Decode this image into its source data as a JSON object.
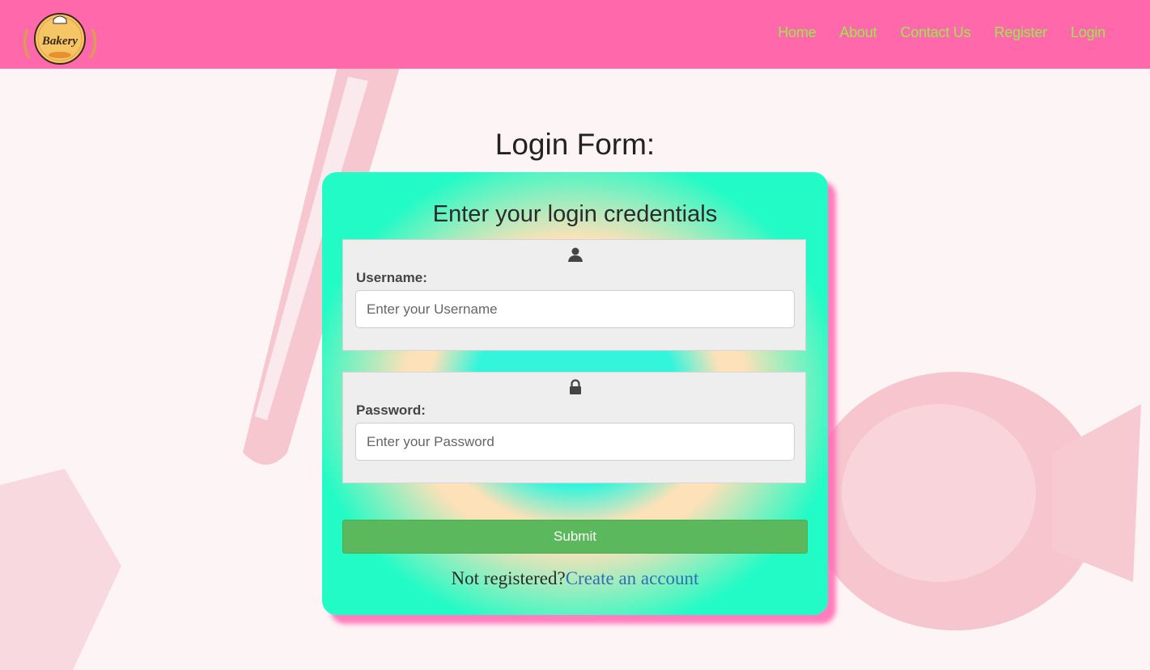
{
  "header": {
    "logo_text": "Bakery",
    "nav": [
      {
        "label": "Home"
      },
      {
        "label": "About"
      },
      {
        "label": "Contact Us"
      },
      {
        "label": "Register"
      },
      {
        "label": "Login"
      }
    ]
  },
  "page": {
    "title": "Login Form:"
  },
  "form": {
    "heading": "Enter your login credentials",
    "username": {
      "icon": "user-icon",
      "label": "Username:",
      "value": "",
      "placeholder": "Enter your Username"
    },
    "password": {
      "icon": "lock-icon",
      "label": "Password:",
      "value": "",
      "placeholder": "Enter your Password"
    },
    "submit_label": "Submit",
    "register_prompt": "Not registered?",
    "register_link": "Create an account"
  },
  "colors": {
    "header_bg": "#ff69ac",
    "nav_text": "#9be84b",
    "submit_bg": "#5cb85c",
    "link": "#2f6fb3",
    "card_shadow": "#ff69b4"
  }
}
